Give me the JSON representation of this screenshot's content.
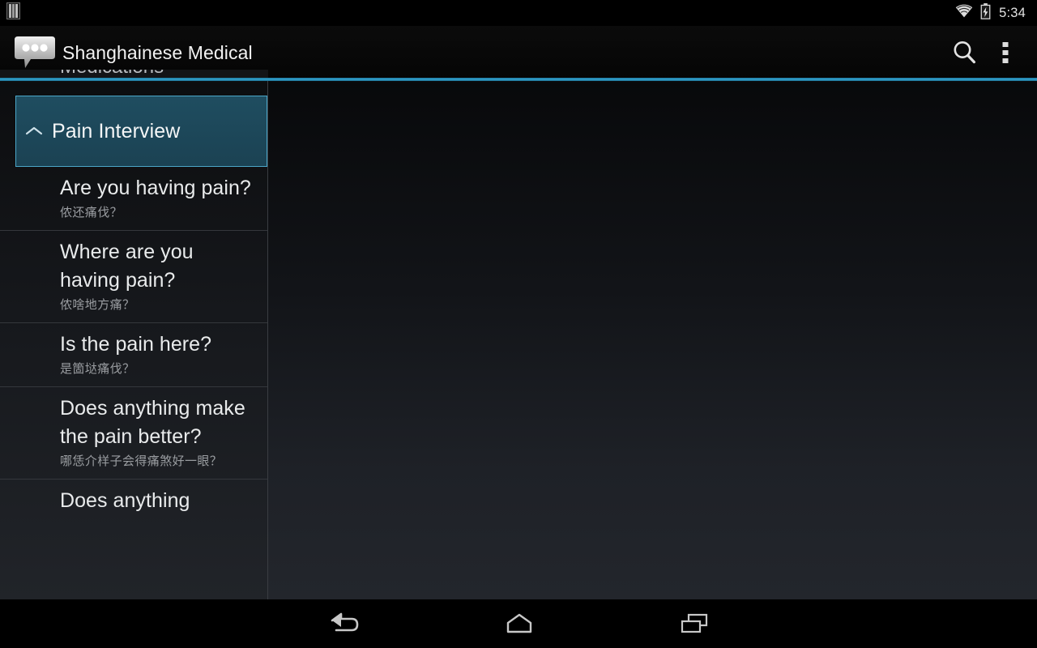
{
  "status_bar": {
    "left_icons": [
      "sim-card-icon"
    ],
    "wifi_icon": "wifi-icon",
    "battery_icon": "battery-charging-icon",
    "clock": "5:34"
  },
  "action_bar": {
    "logo_icon": "speech-bubble-icon",
    "title": "Shanghainese Medical",
    "search_icon": "search-icon",
    "overflow_icon": "overflow-menu-icon",
    "accent_color": "#33a5d1"
  },
  "list_panel": {
    "scrolled_partial_row": "Medications",
    "group_header": {
      "label": "Pain Interview",
      "chevron_icon": "chevron-up-icon",
      "expanded": true,
      "selected": true,
      "fill_color": "#1f4d60",
      "border_color": "#4ba6c8"
    },
    "rows": [
      {
        "english": "Are you having pain?",
        "shanghainese": "侬还痛伐？"
      },
      {
        "english": "Where are you having pain?",
        "shanghainese": "侬啥地方痛？"
      },
      {
        "english": "Is the pain here?",
        "shanghainese": "是箇垯痛伐？"
      },
      {
        "english": "Does anything make the pain better?",
        "shanghainese": "哪恁介样子会得痛煞好一眼？"
      },
      {
        "english": "Does anything",
        "shanghainese": ""
      }
    ]
  },
  "detail_pane": {
    "content": ""
  },
  "nav_bar": {
    "back_icon": "back-arrow-icon",
    "home_icon": "home-icon",
    "recents_icon": "recent-apps-icon"
  }
}
